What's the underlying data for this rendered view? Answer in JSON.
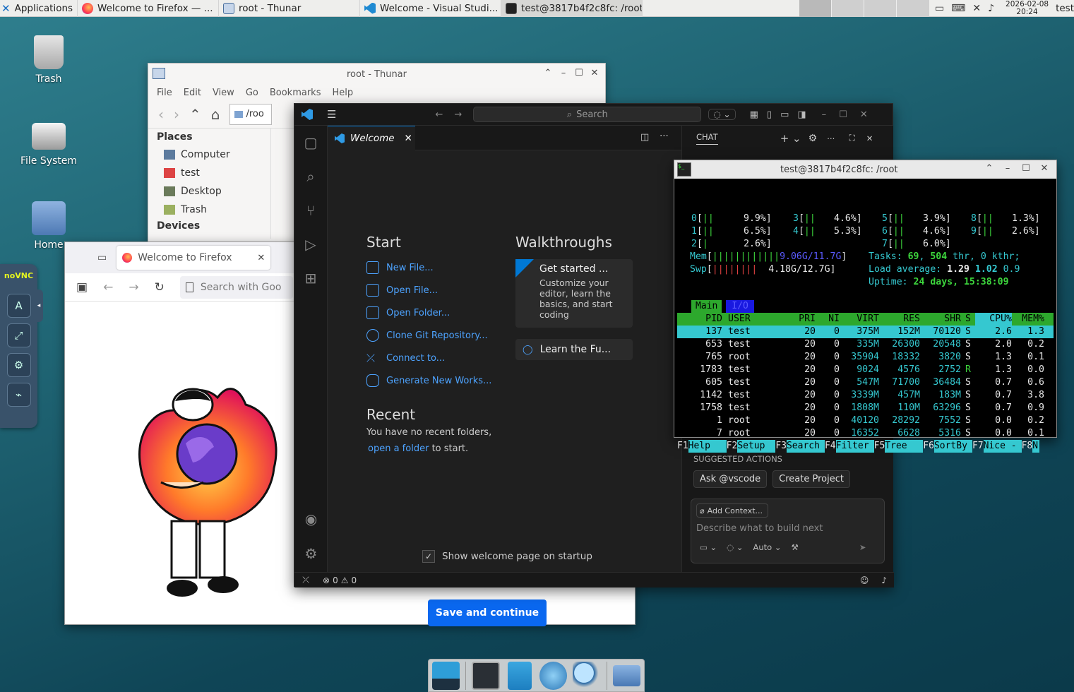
{
  "panel": {
    "apps_label": "Applications",
    "tasks": [
      {
        "label": "Welcome to Firefox — ...",
        "icon": "firefox-icon"
      },
      {
        "label": "root - Thunar",
        "icon": "folder-icon"
      },
      {
        "label": "Welcome - Visual Studi...",
        "icon": "vscode-icon"
      },
      {
        "label": "test@3817b4f2c8fc: /root",
        "icon": "terminal-icon"
      }
    ],
    "date": "2026-02-08",
    "time": "20:24",
    "user": "test"
  },
  "desktop": {
    "icons": [
      {
        "label": "Trash"
      },
      {
        "label": "File System"
      },
      {
        "label": "Home"
      }
    ]
  },
  "thunar": {
    "title": "root - Thunar",
    "menu": [
      "File",
      "Edit",
      "View",
      "Go",
      "Bookmarks",
      "Help"
    ],
    "location": "/roo",
    "places_header": "Places",
    "places": [
      "Computer",
      "test",
      "Desktop",
      "Trash"
    ],
    "devices_header": "Devices"
  },
  "firefox": {
    "tab_title": "Welcome to Firefox",
    "search_placeholder": "Search with Goo",
    "save_button": "Save and continue"
  },
  "vscode": {
    "search_placeholder": "Search",
    "tab_label": "Welcome",
    "start_heading": "Start",
    "start_items": [
      "New File...",
      "Open File...",
      "Open Folder...",
      "Clone Git Repository...",
      "Connect to...",
      "Generate New Works..."
    ],
    "walkthroughs_heading": "Walkthroughs",
    "walk_title": "Get started ...",
    "walk_desc": "Customize your editor, learn the basics, and start coding",
    "walk_learn": "Learn the Fu...",
    "recent_heading": "Recent",
    "recent_text": "You have no recent folders,",
    "recent_link": "open a folder",
    "recent_suffix": "to start.",
    "show_welcome": "Show welcome page on startup",
    "chat_label": "CHAT",
    "suggested_header": "SUGGESTED ACTIONS",
    "suggest_ask": "Ask @vscode",
    "suggest_create": "Create Project",
    "add_context": "Add Context...",
    "chat_placeholder": "Describe what to build next",
    "mode_label": "Auto",
    "errors": "0",
    "warnings": "0"
  },
  "terminal": {
    "title": "test@3817b4f2c8fc: /root",
    "cpus": [
      {
        "id": "0",
        "pct": "9.9%"
      },
      {
        "id": "1",
        "pct": "6.5%"
      },
      {
        "id": "2",
        "pct": "2.6%"
      },
      {
        "id": "3",
        "pct": "4.6%"
      },
      {
        "id": "4",
        "pct": "5.3%"
      },
      {
        "id": "5",
        "pct": "3.9%"
      },
      {
        "id": "6",
        "pct": "4.6%"
      },
      {
        "id": "7",
        "pct": "6.0%"
      },
      {
        "id": "8",
        "pct": "1.3%"
      },
      {
        "id": "9",
        "pct": "2.6%"
      }
    ],
    "mem": "9.06G/11.7G",
    "swp": "4.18G/12.7G",
    "tasks": "69",
    "threads": "504",
    "kthr": "0",
    "load1": "1.29",
    "load5": "1.02",
    "load15": "0.9",
    "uptime": "24 days, 15:38:09",
    "tab_main": "Main",
    "tab_io": "I/O",
    "headers": [
      "PID",
      "USER",
      "PRI",
      "NI",
      "VIRT",
      "RES",
      "SHR",
      "S",
      "CPU%",
      "MEM%"
    ],
    "rows": [
      [
        "137",
        "test",
        "20",
        "0",
        "375M",
        "152M",
        "70120",
        "S",
        "2.6",
        "1.3"
      ],
      [
        "653",
        "test",
        "20",
        "0",
        "335M",
        "26300",
        "20548",
        "S",
        "2.0",
        "0.2"
      ],
      [
        "765",
        "root",
        "20",
        "0",
        "35904",
        "18332",
        "3820",
        "S",
        "1.3",
        "0.1"
      ],
      [
        "1783",
        "test",
        "20",
        "0",
        "9024",
        "4576",
        "2752",
        "R",
        "1.3",
        "0.0"
      ],
      [
        "605",
        "test",
        "20",
        "0",
        "547M",
        "71700",
        "36484",
        "S",
        "0.7",
        "0.6"
      ],
      [
        "1142",
        "test",
        "20",
        "0",
        "3339M",
        "457M",
        "183M",
        "S",
        "0.7",
        "3.8"
      ],
      [
        "1758",
        "test",
        "20",
        "0",
        "1808M",
        "110M",
        "63296",
        "S",
        "0.7",
        "0.9"
      ],
      [
        "1",
        "root",
        "20",
        "0",
        "40120",
        "28292",
        "7552",
        "S",
        "0.0",
        "0.2"
      ],
      [
        "7",
        "root",
        "20",
        "0",
        "16352",
        "6628",
        "5316",
        "S",
        "0.0",
        "0.1"
      ]
    ],
    "fkeys": [
      [
        "F1",
        "Help"
      ],
      [
        "F2",
        "Setup"
      ],
      [
        "F3",
        "Search"
      ],
      [
        "F4",
        "Filter"
      ],
      [
        "F5",
        "Tree"
      ],
      [
        "F6",
        "SortBy"
      ],
      [
        "F7",
        "Nice -"
      ],
      [
        "F8",
        "N"
      ]
    ]
  },
  "vnc": {
    "logo": "noVNC"
  }
}
